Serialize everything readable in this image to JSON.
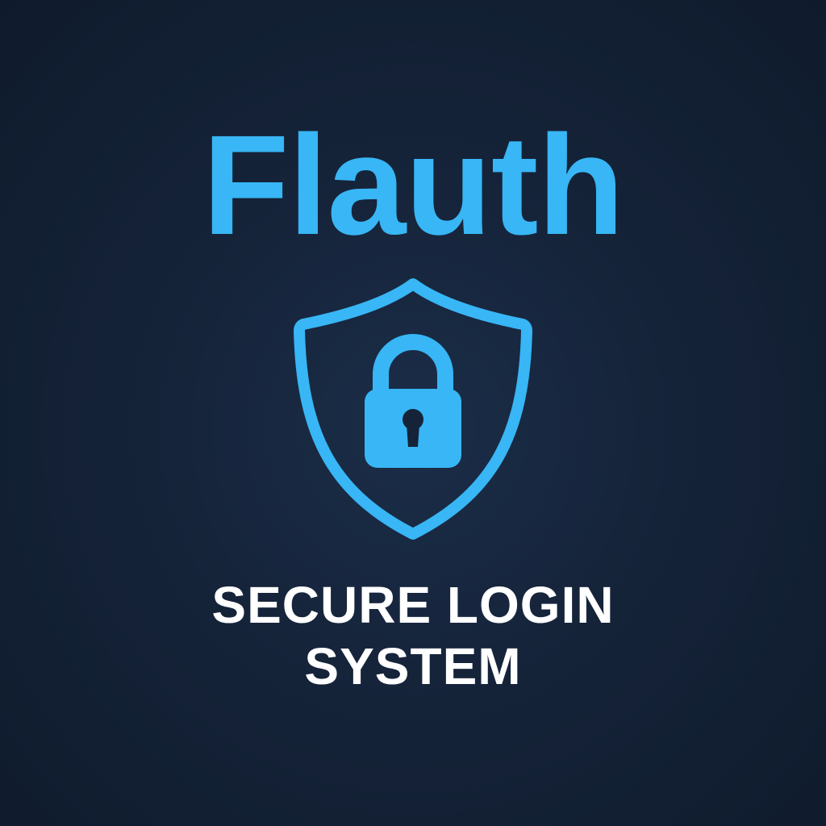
{
  "brand": {
    "title": "Flauth",
    "icon": "shield-lock-icon",
    "accent_color": "#38b6f5"
  },
  "tagline": {
    "line1": "SECURE LOGIN",
    "line2": "SYSTEM",
    "color": "#ffffff"
  },
  "background": {
    "center_color": "#1b2d48",
    "edge_color": "#0f1b2c"
  }
}
